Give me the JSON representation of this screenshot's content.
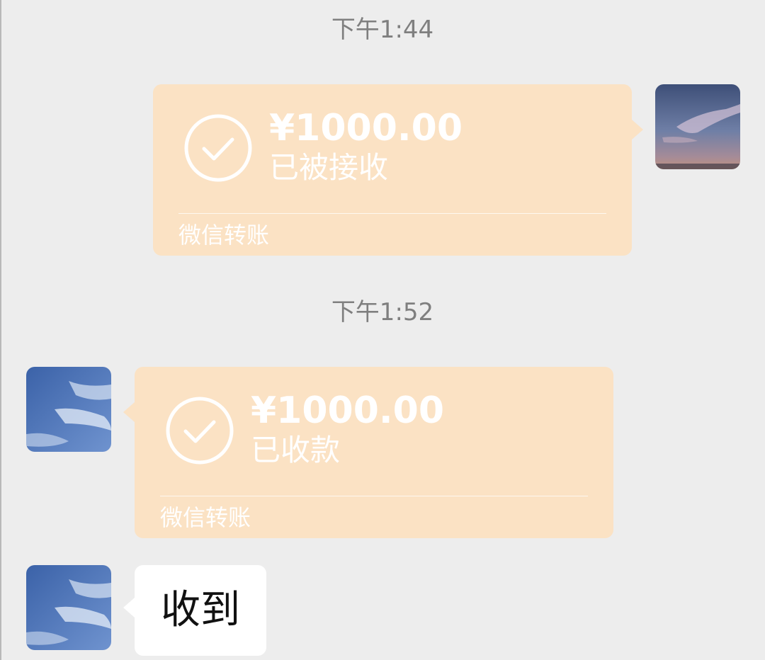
{
  "colors": {
    "background": "#ededed",
    "transfer_bubble": "#fbe2c4",
    "timestamp_text": "#7f7f7f",
    "text_bubble": "#ffffff"
  },
  "messages": [
    {
      "type": "timestamp",
      "text": "下午1:44"
    },
    {
      "type": "transfer",
      "direction": "outgoing",
      "amount": "¥1000.00",
      "status": "已被接收",
      "footer": "微信转账",
      "icon": "check-circle-icon"
    },
    {
      "type": "timestamp",
      "text": "下午1:52"
    },
    {
      "type": "transfer",
      "direction": "incoming",
      "amount": "¥1000.00",
      "status": "已收款",
      "footer": "微信转账",
      "icon": "check-circle-icon"
    },
    {
      "type": "text",
      "direction": "incoming",
      "text": "收到"
    }
  ]
}
